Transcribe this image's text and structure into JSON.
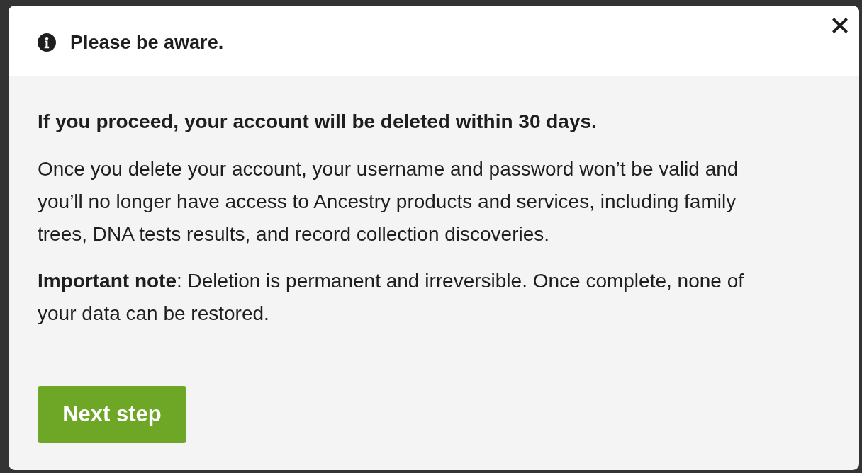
{
  "dialog": {
    "title": "Please be aware.",
    "heading": "If you proceed, your account will be deleted within 30 days.",
    "paragraphs": [
      "Once you delete your account, your username and password won’t be valid and you’ll no longer have access to Ancestry products and services, including family trees, DNA tests results, and record collection discoveries.",
      "**Important note**: Deletion is permanent and irreversible. Once complete, none of your data can be restored."
    ],
    "button": "Next step"
  }
}
